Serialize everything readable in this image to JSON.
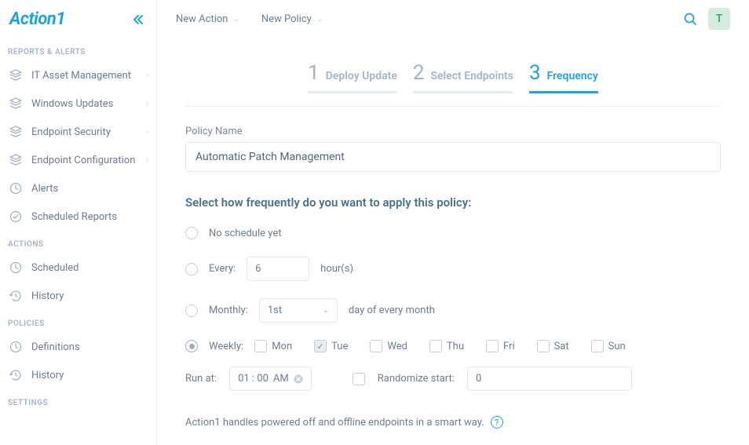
{
  "brand": "Action1",
  "topbar": {
    "new_action": "New Action",
    "new_policy": "New Policy",
    "avatar_initial": "T"
  },
  "sidebar": {
    "sections": {
      "reports": {
        "title": "REPORTS & ALERTS",
        "items": [
          "IT Asset Management",
          "Windows Updates",
          "Endpoint Security",
          "Endpoint Configuration",
          "Alerts",
          "Scheduled Reports"
        ]
      },
      "actions": {
        "title": "ACTIONS",
        "items": [
          "Scheduled",
          "History"
        ]
      },
      "policies": {
        "title": "POLICIES",
        "items": [
          "Definitions",
          "History"
        ]
      },
      "settings": {
        "title": "SETTINGS"
      }
    }
  },
  "wizard": {
    "steps": [
      "Deploy Update",
      "Select Endpoints",
      "Frequency"
    ],
    "active_step": 3,
    "policy_name_label": "Policy Name",
    "policy_name_value": "Automatic Patch Management",
    "frequency_title": "Select how frequently do you want to apply this policy:",
    "option_no_schedule": "No schedule yet",
    "option_every_label": "Every:",
    "option_every_value": "6",
    "option_every_unit": "hour(s)",
    "option_monthly_label": "Monthly:",
    "option_monthly_value": "1st",
    "option_monthly_suffix": "day of every month",
    "option_weekly_label": "Weekly:",
    "days": [
      "Mon",
      "Tue",
      "Wed",
      "Thu",
      "Fri",
      "Sat",
      "Sun"
    ],
    "days_checked": [
      false,
      true,
      false,
      false,
      false,
      false,
      false
    ],
    "runat_label": "Run at:",
    "runat_time": "01 : 00",
    "runat_ampm": "AM",
    "randomize_label": "Randomize start:",
    "randomize_value": "0",
    "note_text": "Action1 handles powered off and offline endpoints in a smart way."
  }
}
